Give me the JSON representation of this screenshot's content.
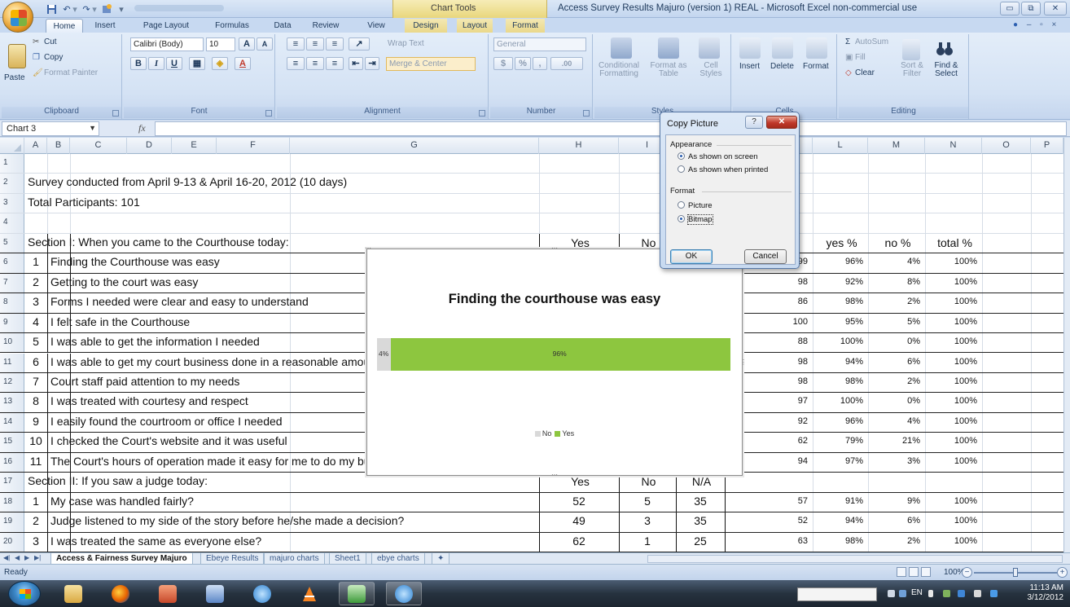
{
  "window": {
    "title": "Access Survey Results Majuro (version 1) REAL - Microsoft Excel non-commercial use",
    "context_tab_group": "Chart Tools",
    "controls": {
      "minimize": "▭",
      "maximize": "⧉",
      "close": "✕"
    }
  },
  "quick_access": {
    "more": "▾"
  },
  "ribbon_tabs": [
    "Home",
    "Insert",
    "Page Layout",
    "Formulas",
    "Data",
    "Review",
    "View",
    "Design",
    "Layout",
    "Format"
  ],
  "ribbon": {
    "clipboard": {
      "paste": "Paste",
      "cut": "Cut",
      "copy": "Copy",
      "format_painter": "Format Painter",
      "label": "Clipboard"
    },
    "font": {
      "name": "Calibri (Body)",
      "size": "10",
      "grow": "A",
      "shrink": "A",
      "bold": "B",
      "italic": "I",
      "underline": "U",
      "font_color": "A",
      "label": "Font"
    },
    "alignment": {
      "wrap_text": "Wrap Text",
      "merge_center": "Merge & Center",
      "label": "Alignment"
    },
    "number": {
      "format": "General",
      "currency": "$",
      "percent": "%",
      "comma": ",",
      "inc_dec": ".00",
      "label": "Number"
    },
    "styles": {
      "conditional": "Conditional Formatting",
      "format_table": "Format as Table",
      "cell_styles": "Cell Styles",
      "label": "Styles"
    },
    "cells": {
      "insert": "Insert",
      "delete": "Delete",
      "format": "Format",
      "label": "Cells"
    },
    "editing": {
      "autosum": "AutoSum",
      "fill": "Fill",
      "clear": "Clear",
      "sort_filter": "Sort & Filter",
      "find_select": "Find & Select",
      "label": "Editing"
    }
  },
  "formula_bar": {
    "name_box": "Chart 3",
    "fx": "fx",
    "value": ""
  },
  "columns": [
    "A",
    "B",
    "C",
    "D",
    "E",
    "F",
    "G",
    "H",
    "I",
    "J",
    "K",
    "L",
    "M",
    "N",
    "O",
    "P"
  ],
  "rows": [
    {
      "n": "1"
    },
    {
      "n": "2",
      "text": "Survey conducted from April 9-13 & April 16-20, 2012  (10 days)"
    },
    {
      "n": "3",
      "text": "Total Participants:  101"
    },
    {
      "n": "4"
    },
    {
      "n": "5",
      "text": "Section I:  When you came to the Courthouse today:",
      "h": "Yes",
      "i": "No",
      "k": "es",
      "l": "yes %",
      "m": "no %",
      "nn": "total %"
    },
    {
      "n": "6",
      "b": "1",
      "text": "Finding the Courthouse was easy",
      "k": "99",
      "l": "96%",
      "m": "4%",
      "nn": "100%"
    },
    {
      "n": "7",
      "b": "2",
      "text": "Getting to the court was easy",
      "k": "98",
      "l": "92%",
      "m": "8%",
      "nn": "100%"
    },
    {
      "n": "8",
      "b": "3",
      "text": "Forms I needed were clear and easy to understand",
      "k": "86",
      "l": "98%",
      "m": "2%",
      "nn": "100%"
    },
    {
      "n": "9",
      "b": "4",
      "text": "I felt safe in the Courthouse",
      "k": "100",
      "l": "95%",
      "m": "5%",
      "nn": "100%"
    },
    {
      "n": "10",
      "b": "5",
      "text": "I was able to get the information I needed",
      "k": "88",
      "l": "100%",
      "m": "0%",
      "nn": "100%"
    },
    {
      "n": "11",
      "b": "6",
      "text": "I was able to get my court business done in a reasonable amount of time",
      "k": "98",
      "l": "94%",
      "m": "6%",
      "nn": "100%"
    },
    {
      "n": "12",
      "b": "7",
      "text": "Court staff paid attention to my needs",
      "k": "98",
      "l": "98%",
      "m": "2%",
      "nn": "100%"
    },
    {
      "n": "13",
      "b": "8",
      "text": "I was treated with courtesy and respect",
      "k": "97",
      "l": "100%",
      "m": "0%",
      "nn": "100%"
    },
    {
      "n": "14",
      "b": "9",
      "text": "I easily found the courtroom or office I needed",
      "k": "92",
      "l": "96%",
      "m": "4%",
      "nn": "100%"
    },
    {
      "n": "15",
      "b": "10",
      "text": "I checked the Court's website and it was useful",
      "k": "62",
      "l": "79%",
      "m": "21%",
      "nn": "100%"
    },
    {
      "n": "16",
      "b": "11",
      "text": "The Court's hours of operation made it easy for me to do my business",
      "k": "94",
      "l": "97%",
      "m": "3%",
      "nn": "100%"
    },
    {
      "n": "17",
      "text": "Section II:  If you saw a judge today:",
      "h": "Yes",
      "i": "No",
      "j": "N/A"
    },
    {
      "n": "18",
      "b": "1",
      "text": "My case was handled fairly?",
      "h": "52",
      "i": "5",
      "j": "35",
      "k": "57",
      "l": "91%",
      "m": "9%",
      "nn": "100%"
    },
    {
      "n": "19",
      "b": "2",
      "text": "Judge listened to my side of the story before he/she made a decision?",
      "h": "49",
      "i": "3",
      "j": "35",
      "k": "52",
      "l": "94%",
      "m": "6%",
      "nn": "100%"
    },
    {
      "n": "20",
      "b": "3",
      "text": "I was treated the same as everyone else?",
      "h": "62",
      "i": "1",
      "j": "25",
      "k": "63",
      "l": "98%",
      "m": "2%",
      "nn": "100%"
    }
  ],
  "chart_data": {
    "type": "bar",
    "orientation": "horizontal-stacked-100",
    "title": "Finding the courthouse was easy",
    "categories": [
      ""
    ],
    "series": [
      {
        "name": "No",
        "values": [
          4
        ],
        "label": "4%",
        "color": "#d9d9d9"
      },
      {
        "name": "Yes",
        "values": [
          96
        ],
        "label": "96%",
        "color": "#8dc63f"
      }
    ],
    "xlim": [
      0,
      100
    ],
    "legend": "bottom"
  },
  "dialog": {
    "title": "Copy Picture",
    "help": "?",
    "close": "✕",
    "appearance_label": "Appearance",
    "appearance_options": [
      "As shown on screen",
      "As shown when printed"
    ],
    "appearance_selected": 0,
    "format_label": "Format",
    "format_options": [
      "Picture",
      "Bitmap"
    ],
    "format_selected": 1,
    "ok": "OK",
    "cancel": "Cancel"
  },
  "sheet_tabs": [
    "Access & Fairness Survey Majuro",
    "Ebeye Results",
    "majuro charts",
    "Sheet1",
    "ebye charts"
  ],
  "active_sheet_tab": 0,
  "status": {
    "text": "Ready",
    "zoom": "100%",
    "zoom_fraction": 0.5
  },
  "taskbar": {
    "lang": "EN",
    "time": "11:13 AM",
    "date": "3/12/2012"
  }
}
